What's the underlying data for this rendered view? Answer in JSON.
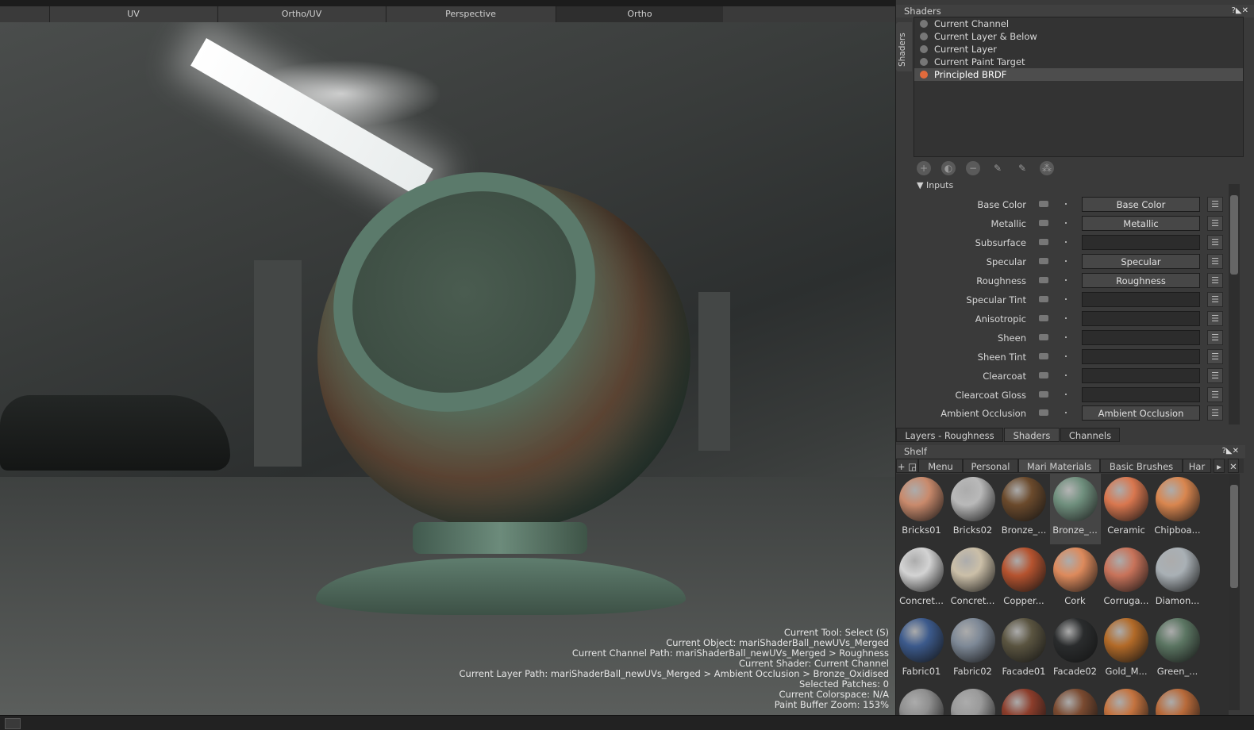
{
  "view_tabs": [
    "UV",
    "Ortho/UV",
    "Perspective",
    "Ortho"
  ],
  "active_view_tab": "Ortho",
  "viewport_info": [
    "Current Tool: Select (S)",
    "Current Object: mariShaderBall_newUVs_Merged",
    "Current Channel Path: mariShaderBall_newUVs_Merged > Roughness",
    "Current Shader: Current Channel",
    "Current Layer Path: mariShaderBall_newUVs_Merged > Ambient Occlusion > Bronze_Oxidised",
    "Selected Patches: 0",
    "Current Colorspace: N/A",
    "Paint Buffer Zoom: 153%"
  ],
  "shaders_panel": {
    "title": "Shaders",
    "side_tab": "Shaders",
    "controls": "?◣✕",
    "items": [
      "Current Channel",
      "Current Layer & Below",
      "Current Layer",
      "Current Paint Target",
      "Principled BRDF"
    ],
    "selected": "Principled BRDF",
    "selected_color": "#e06a3c",
    "inputs_header": "Inputs",
    "inputs": [
      {
        "label": "Base Color",
        "slot": "Base Color"
      },
      {
        "label": "Metallic",
        "slot": "Metallic"
      },
      {
        "label": "Subsurface",
        "slot": ""
      },
      {
        "label": "Specular",
        "slot": "Specular"
      },
      {
        "label": "Roughness",
        "slot": "Roughness"
      },
      {
        "label": "Specular Tint",
        "slot": ""
      },
      {
        "label": "Anisotropic",
        "slot": ""
      },
      {
        "label": "Sheen",
        "slot": ""
      },
      {
        "label": "Sheen Tint",
        "slot": ""
      },
      {
        "label": "Clearcoat",
        "slot": ""
      },
      {
        "label": "Clearcoat Gloss",
        "slot": ""
      },
      {
        "label": "Ambient Occlusion",
        "slot": "Ambient Occlusion"
      }
    ]
  },
  "bottom_tabs": [
    "Layers - Roughness",
    "Shaders",
    "Channels"
  ],
  "active_bottom_tab": "Shaders",
  "shelf": {
    "title": "Shelf",
    "controls": "?◣✕",
    "tabs": [
      "Menu",
      "Personal",
      "Mari Materials",
      "Basic Brushes",
      "Har"
    ],
    "active_tab": "Mari Materials",
    "materials": [
      {
        "name": "Bricks01",
        "color": "#c98a6c"
      },
      {
        "name": "Bricks02",
        "color": "#b9b9b9"
      },
      {
        "name": "Bronze_...",
        "color": "#6b4a2c"
      },
      {
        "name": "Bronze_...",
        "color": "#6f8f7d",
        "selected": true
      },
      {
        "name": "Ceramic",
        "color": "#d9774f"
      },
      {
        "name": "Chipboa...",
        "color": "#d9864f"
      },
      {
        "name": "Concret...",
        "color": "#d3d3d3"
      },
      {
        "name": "Concret...",
        "color": "#cbbfa8"
      },
      {
        "name": "Copper...",
        "color": "#b5532f"
      },
      {
        "name": "Cork",
        "color": "#dd8a5c"
      },
      {
        "name": "Corruga...",
        "color": "#c8735a"
      },
      {
        "name": "Diamon...",
        "color": "#a9b0b5"
      },
      {
        "name": "Fabric01",
        "color": "#3c5a8c"
      },
      {
        "name": "Fabric02",
        "color": "#7d8896"
      },
      {
        "name": "Facade01",
        "color": "#5a5440"
      },
      {
        "name": "Facade02",
        "color": "#2a2c2d"
      },
      {
        "name": "Gold_M...",
        "color": "#b26a28"
      },
      {
        "name": "Green_...",
        "color": "#5b7562"
      },
      {
        "name": "",
        "color": "#8f8f8f"
      },
      {
        "name": "",
        "color": "#9a9a9a"
      },
      {
        "name": "",
        "color": "#8c3d2b"
      },
      {
        "name": "",
        "color": "#7a4a30"
      },
      {
        "name": "",
        "color": "#c4733f"
      },
      {
        "name": "",
        "color": "#b86a3a"
      }
    ]
  }
}
